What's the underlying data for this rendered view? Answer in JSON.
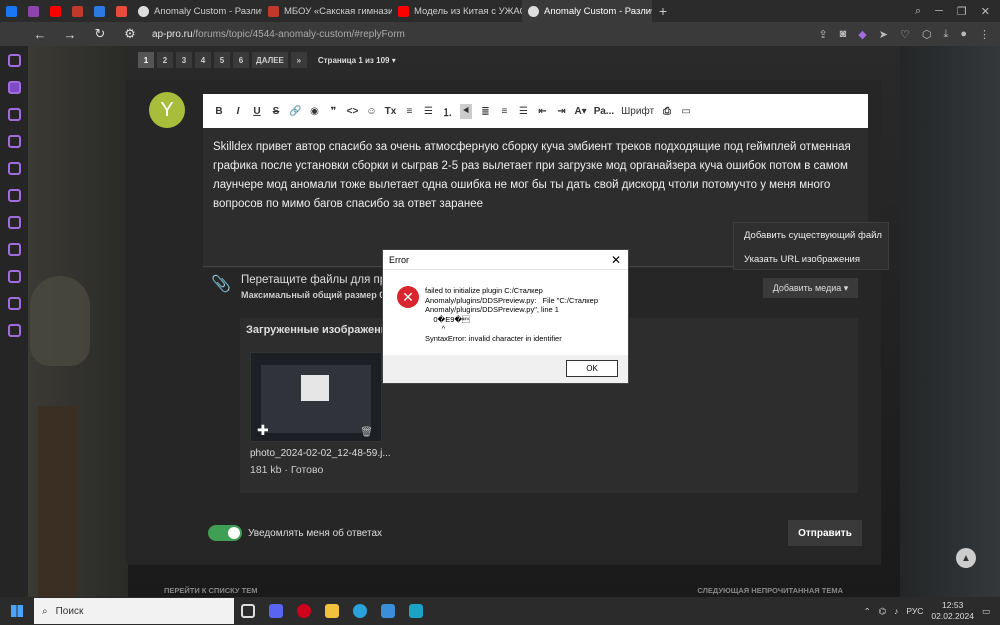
{
  "browser": {
    "tabs": [
      {
        "label": "",
        "color": "#1877f2"
      },
      {
        "label": "",
        "color": "#8e44ad"
      },
      {
        "label": "",
        "color": "#ff0000"
      },
      {
        "label": "",
        "color": "#c0392b"
      },
      {
        "label": "",
        "color": "#2a7ae2"
      },
      {
        "label": "",
        "color": "#e74c3c"
      },
      {
        "label": "Anomaly Custom - Различ",
        "color": "#dddddd"
      },
      {
        "label": "МБОУ «Сакская гимназия",
        "color": "#c0392b"
      },
      {
        "label": "Модель из Китая с УЖАСН",
        "color": "#ff0000"
      },
      {
        "label": "Anomaly Custom - Различ",
        "color": "#dddddd"
      }
    ],
    "new_tab": "+",
    "url_domain": "ap-pro.ru",
    "url_path": "/forums/topic/4544-anomaly-custom/#replyForm"
  },
  "pager": {
    "pages": [
      "1",
      "2",
      "3",
      "4",
      "5",
      "6"
    ],
    "next": "ДАЛЕЕ",
    "last": "»",
    "info": "Страница 1 из 109 ▾"
  },
  "post": {
    "avatar_letter": "Y",
    "toolbar": {
      "font_size": "Ра...",
      "font": "Шрифт"
    },
    "text": "Skilldex привет автор спасибо за очень атмосферную сборку куча эмбиент треков подходящие под геймплей отменная графика после установки сборки и сыграв 2-5 раз вылетает при загрузке мод органайзера куча ошибок потом в самом лаунчере мод аномали тоже вылетает одна ошибка не мог бы ты дать свой дискорд чтоли потомучто у меня много вопросов по мимо багов спасибо за ответ заранее"
  },
  "attachments": {
    "drop_title": "Перетащите файлы для пр",
    "drop_subtitle": "Максимальный общий размер 0,",
    "add_media": "Добавить медиа ▾",
    "uploaded_title": "Загруженные изображени",
    "file_name": "photo_2024-02-02_12-48-59.j...",
    "file_meta": "181 kb · Готово"
  },
  "context_menu": {
    "items": [
      "Добавить существующий файл",
      "Указать URL изображения"
    ]
  },
  "notify": {
    "label": "Уведомлять меня об ответах",
    "enabled": true
  },
  "submit_label": "Отправить",
  "footer_links": {
    "prev": "ПЕРЕЙТИ К СПИСКУ ТЕМ",
    "next": "СЛЕДУЮЩАЯ НЕПРОЧИТАННАЯ ТЕМА"
  },
  "error_dialog": {
    "title": "Error",
    "message": "failed to initialize plugin C:/Сталкер Anomaly/plugins/DDSPreview.py:   File \"C:/Сталкер Anomaly/plugins/DDSPreview.py\", line 1\n    0�E9�\u0003\n        ^\nSyntaxError: invalid character in identifier",
    "ok_label": "OK"
  },
  "taskbar": {
    "search_label": "Поиск",
    "language": "РУС",
    "time": "12:53",
    "date": "02.02.2024"
  },
  "colors": {
    "accent": "#a36be0",
    "toggle_on": "#3f9f55",
    "error": "#d9262e"
  }
}
